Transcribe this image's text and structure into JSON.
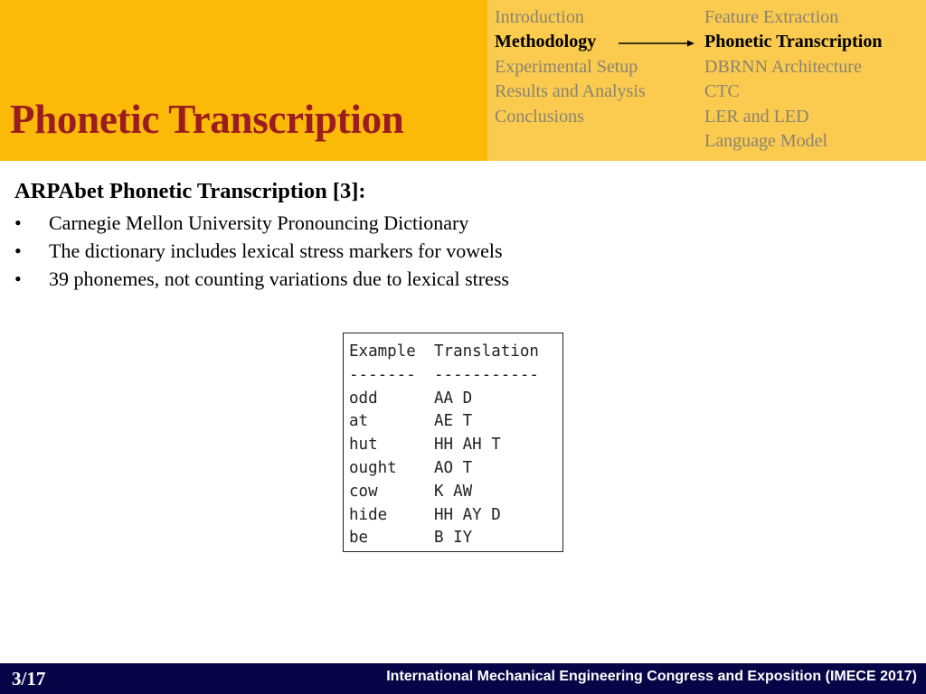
{
  "header": {
    "title": "Phonetic Transcription",
    "colors": {
      "left_bg": "#FBB908",
      "right_bg": "#FBCB4F",
      "title": "#9B1C1F",
      "inactive_nav": "#8A8370"
    },
    "sections": [
      {
        "label": "Introduction",
        "active": false
      },
      {
        "label": "Methodology",
        "active": true
      },
      {
        "label": "Experimental Setup",
        "active": false
      },
      {
        "label": "Results and Analysis",
        "active": false
      },
      {
        "label": "Conclusions",
        "active": false
      }
    ],
    "subsections": [
      {
        "label": "Feature Extraction",
        "active": false
      },
      {
        "label": "Phonetic Transcription",
        "active": true
      },
      {
        "label": "DBRNN Architecture",
        "active": false
      },
      {
        "label": "CTC",
        "active": false
      },
      {
        "label": "LER and LED",
        "active": false
      },
      {
        "label": "Language Model",
        "active": false
      }
    ],
    "arrow_icon": "right-arrow"
  },
  "content": {
    "heading": "ARPAbet Phonetic Transcription [3]:",
    "bullet_glyph": "•",
    "bullets": [
      "Carnegie Mellon University Pronouncing Dictionary",
      "The dictionary includes lexical stress markers for vowels",
      "39 phonemes, not counting variations due to lexical stress"
    ]
  },
  "example_table": {
    "headers": [
      "Example",
      "Translation"
    ],
    "separators": [
      "-------",
      "-----------"
    ],
    "rows": [
      [
        "odd",
        "AA D"
      ],
      [
        "at",
        "AE T"
      ],
      [
        "hut",
        "HH AH T"
      ],
      [
        "ought",
        "AO T"
      ],
      [
        "cow",
        "K AW"
      ],
      [
        "hide",
        "HH AY D"
      ],
      [
        "be",
        "B IY"
      ]
    ]
  },
  "footer": {
    "page": "3/17",
    "conference": "International Mechanical Engineering Congress and Exposition (IMECE 2017)",
    "bg_color": "#050548"
  }
}
